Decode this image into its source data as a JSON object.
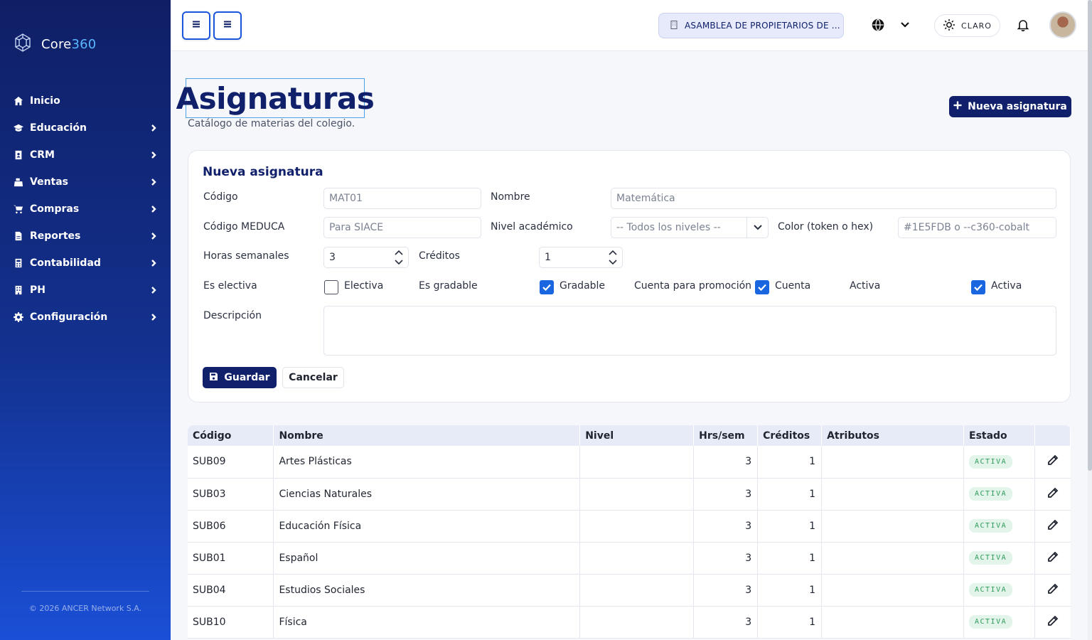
{
  "brand": {
    "name_prefix": "Core",
    "name_suffix": "360"
  },
  "sidebar": {
    "items": [
      {
        "label": "Inicio",
        "icon": "home-icon",
        "has_children": false
      },
      {
        "label": "Educación",
        "icon": "graduation-cap-icon",
        "has_children": true
      },
      {
        "label": "CRM",
        "icon": "address-book-icon",
        "has_children": true
      },
      {
        "label": "Ventas",
        "icon": "cash-register-icon",
        "has_children": true
      },
      {
        "label": "Compras",
        "icon": "cart-icon",
        "has_children": true
      },
      {
        "label": "Reportes",
        "icon": "report-icon",
        "has_children": true
      },
      {
        "label": "Contabilidad",
        "icon": "calculator-icon",
        "has_children": true
      },
      {
        "label": "PH",
        "icon": "building-icon",
        "has_children": true
      },
      {
        "label": "Configuración",
        "icon": "gear-icon",
        "has_children": true
      }
    ],
    "copyright": "© 2026 ANCER Network S.A."
  },
  "topbar": {
    "organization": "ASAMBLEA DE PROPIETARIOS DE ...",
    "theme_label": "CLARO"
  },
  "header": {
    "title": "Asignaturas",
    "subtitle": "Catálogo de materias del colegio.",
    "new_button": "Nueva asignatura"
  },
  "form": {
    "title": "Nueva asignatura",
    "codigo": {
      "label": "Código",
      "placeholder": "MAT01"
    },
    "nombre": {
      "label": "Nombre",
      "placeholder": "Matemática"
    },
    "codigo_meduca": {
      "label": "Código MEDUCA",
      "placeholder": "Para SIACE"
    },
    "nivel": {
      "label": "Nivel académico",
      "selected": "-- Todos los niveles --"
    },
    "color": {
      "label": "Color (token o hex)",
      "placeholder": "#1E5FDB o --c360-cobalt"
    },
    "horas": {
      "label": "Horas semanales",
      "value": "3"
    },
    "creditos": {
      "label": "Créditos",
      "value": "1"
    },
    "electiva": {
      "label": "Es electiva",
      "option": "Electiva",
      "checked": false
    },
    "gradable": {
      "label": "Es gradable",
      "option": "Gradable",
      "checked": true
    },
    "promocion": {
      "label": "Cuenta para promoción",
      "option": "Cuenta",
      "checked": true
    },
    "activa": {
      "label": "Activa",
      "option": "Activa",
      "checked": true
    },
    "descripcion": {
      "label": "Descripción",
      "value": ""
    },
    "save_label": "Guardar",
    "cancel_label": "Cancelar"
  },
  "table": {
    "headers": [
      "Código",
      "Nombre",
      "Nivel",
      "Hrs/sem",
      "Créditos",
      "Atributos",
      "Estado"
    ],
    "rows": [
      {
        "codigo": "SUB09",
        "nombre": "Artes Plásticas",
        "nivel": "",
        "hrs": "3",
        "creditos": "1",
        "atributos": "",
        "estado": "ACTIVA"
      },
      {
        "codigo": "SUB03",
        "nombre": "Ciencias Naturales",
        "nivel": "",
        "hrs": "3",
        "creditos": "1",
        "atributos": "",
        "estado": "ACTIVA"
      },
      {
        "codigo": "SUB06",
        "nombre": "Educación Física",
        "nivel": "",
        "hrs": "3",
        "creditos": "1",
        "atributos": "",
        "estado": "ACTIVA"
      },
      {
        "codigo": "SUB01",
        "nombre": "Español",
        "nivel": "",
        "hrs": "3",
        "creditos": "1",
        "atributos": "",
        "estado": "ACTIVA"
      },
      {
        "codigo": "SUB04",
        "nombre": "Estudios Sociales",
        "nivel": "",
        "hrs": "3",
        "creditos": "1",
        "atributos": "",
        "estado": "ACTIVA"
      },
      {
        "codigo": "SUB10",
        "nombre": "Física",
        "nivel": "",
        "hrs": "3",
        "creditos": "1",
        "atributos": "",
        "estado": "ACTIVA"
      }
    ]
  },
  "colors": {
    "navy": "#10206a",
    "accent": "#1a66e0",
    "success": "#2e9a5a"
  }
}
